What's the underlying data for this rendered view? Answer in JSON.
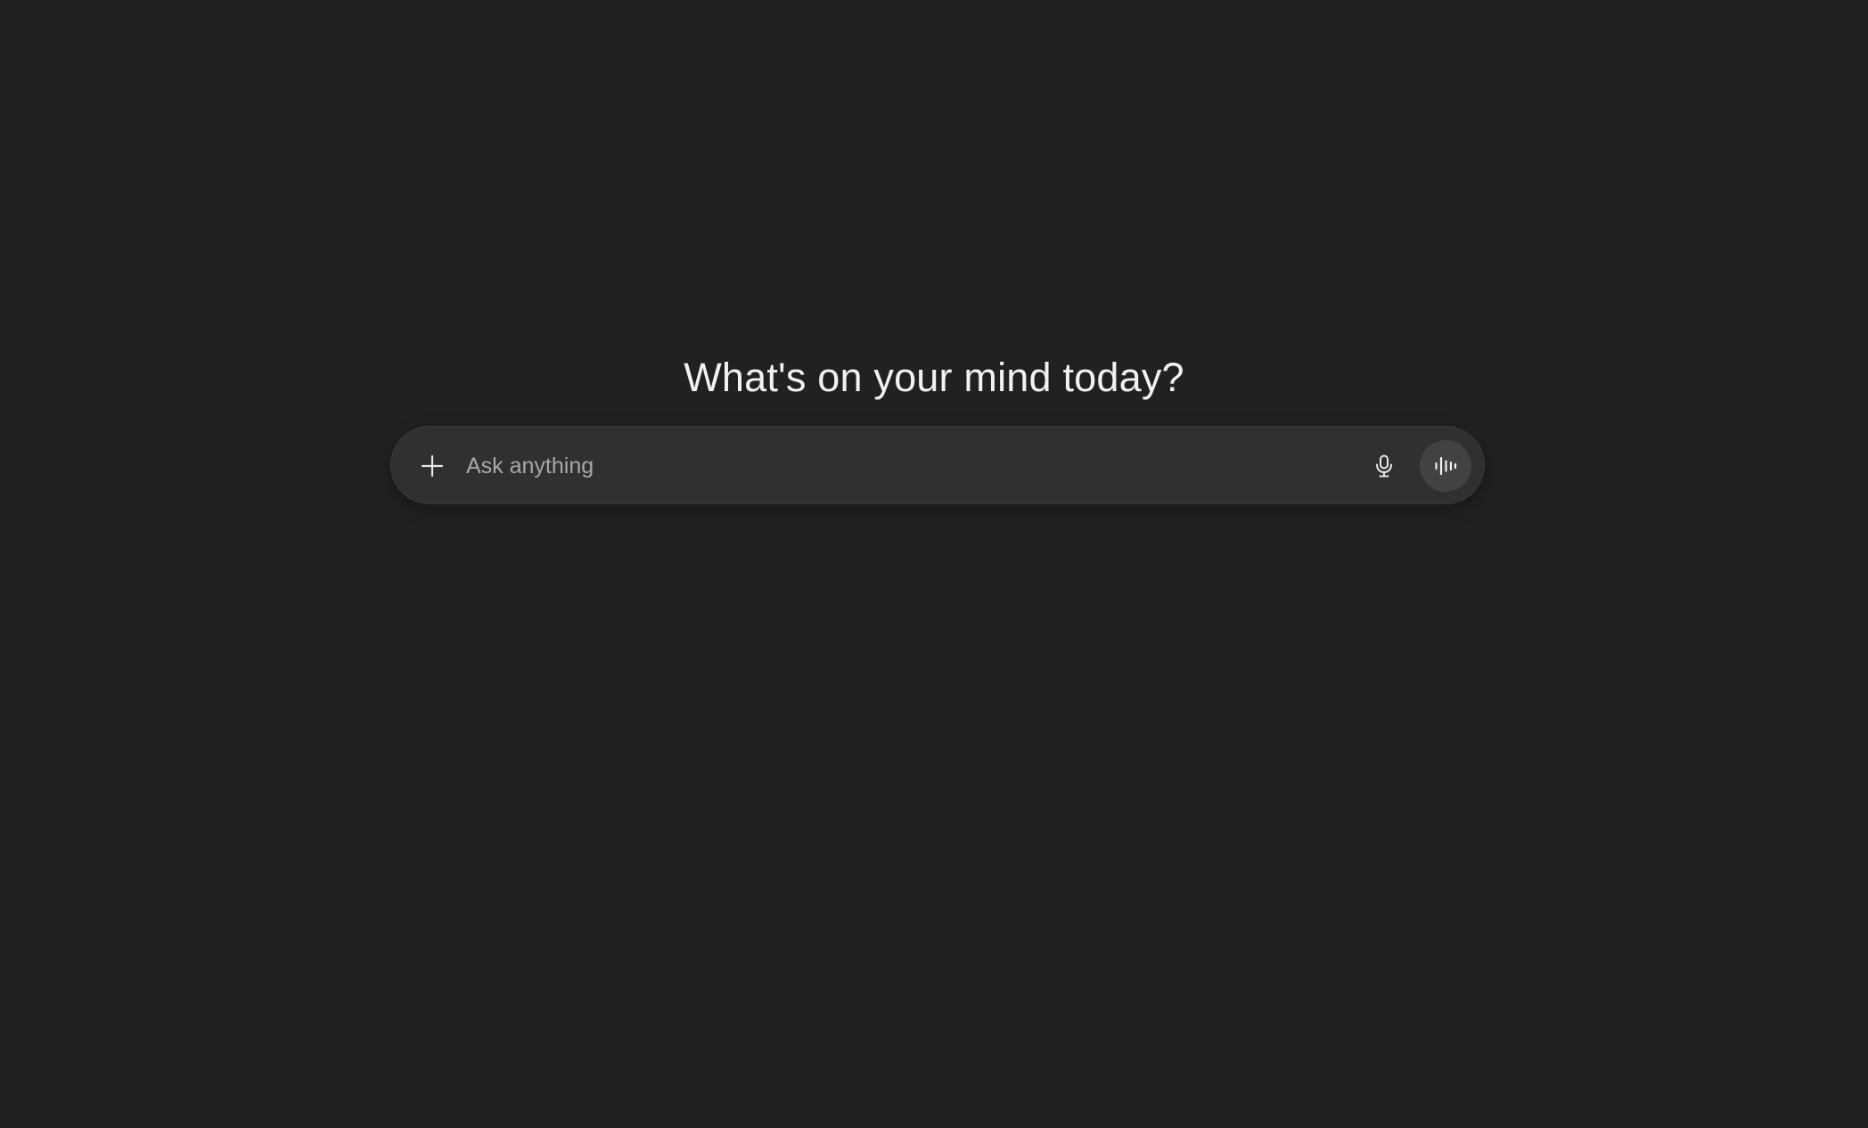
{
  "main": {
    "headline": "What's on your mind today?"
  },
  "composer": {
    "placeholder": "Ask anything",
    "value": "",
    "add_icon": "plus-icon",
    "dictate_icon": "microphone-icon",
    "voice_icon": "voice-waveform-icon"
  },
  "colors": {
    "background": "#212121",
    "composer_background": "#303030",
    "voice_button_background": "#424242",
    "text": "#f2f2f2",
    "placeholder": "#a8a8a8"
  }
}
